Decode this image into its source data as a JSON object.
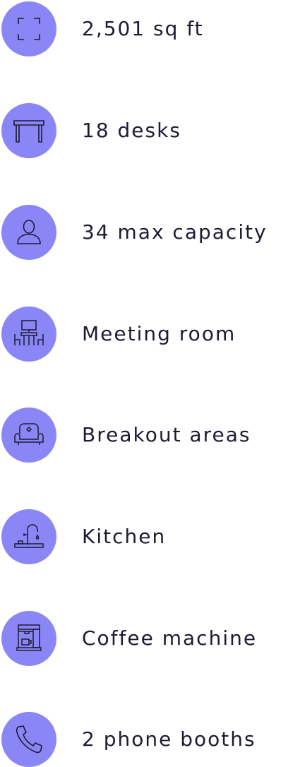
{
  "features": [
    {
      "icon": "area-corners-icon",
      "label": "2,501 sq ft"
    },
    {
      "icon": "desk-icon",
      "label": "18 desks"
    },
    {
      "icon": "person-icon",
      "label": "34 max capacity"
    },
    {
      "icon": "meeting-table-icon",
      "label": "Meeting room"
    },
    {
      "icon": "armchair-icon",
      "label": "Breakout areas"
    },
    {
      "icon": "faucet-icon",
      "label": "Kitchen"
    },
    {
      "icon": "coffee-machine-icon",
      "label": "Coffee machine"
    },
    {
      "icon": "phone-icon",
      "label": "2 phone booths"
    }
  ],
  "colors": {
    "icon_bg": "#8b86f5",
    "icon_stroke": "#1d1b34",
    "text": "#1d1b34"
  }
}
